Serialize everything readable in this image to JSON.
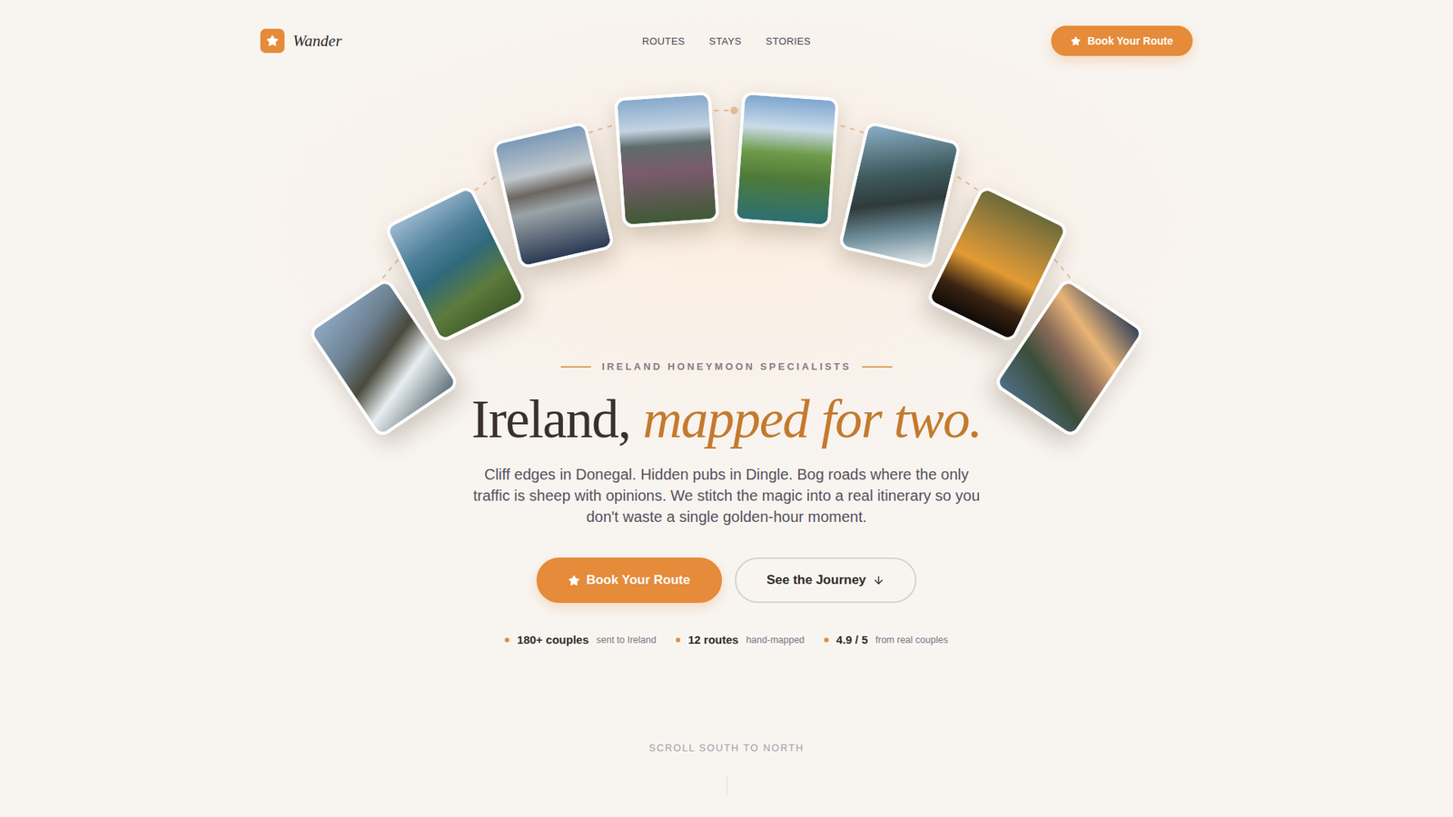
{
  "brand": {
    "name": "Wander"
  },
  "nav": {
    "links": [
      "ROUTES",
      "STAYS",
      "STORIES"
    ],
    "cta": "Book Your Route"
  },
  "hero": {
    "eyebrow": "IRELAND HONEYMOON SPECIALISTS",
    "title": "Ireland,",
    "title_accent": "mapped for two.",
    "body": "Cliff edges in Donegal. Hidden pubs in Dingle. Bog roads where the only traffic is sheep with opinions. We stitch the magic into a real itinerary so you don't waste a single golden-hour moment.",
    "primary_button": "Book Your Route",
    "secondary_button": "See the Journey"
  },
  "stats": [
    {
      "value": "180+ couples",
      "label": "sent to Ireland"
    },
    {
      "value": "12 routes",
      "label": "hand-mapped"
    },
    {
      "value": "4.9 / 5",
      "label": "from real couples"
    }
  ],
  "scroll_hint": "SCROLL SOUTH TO NORTH"
}
